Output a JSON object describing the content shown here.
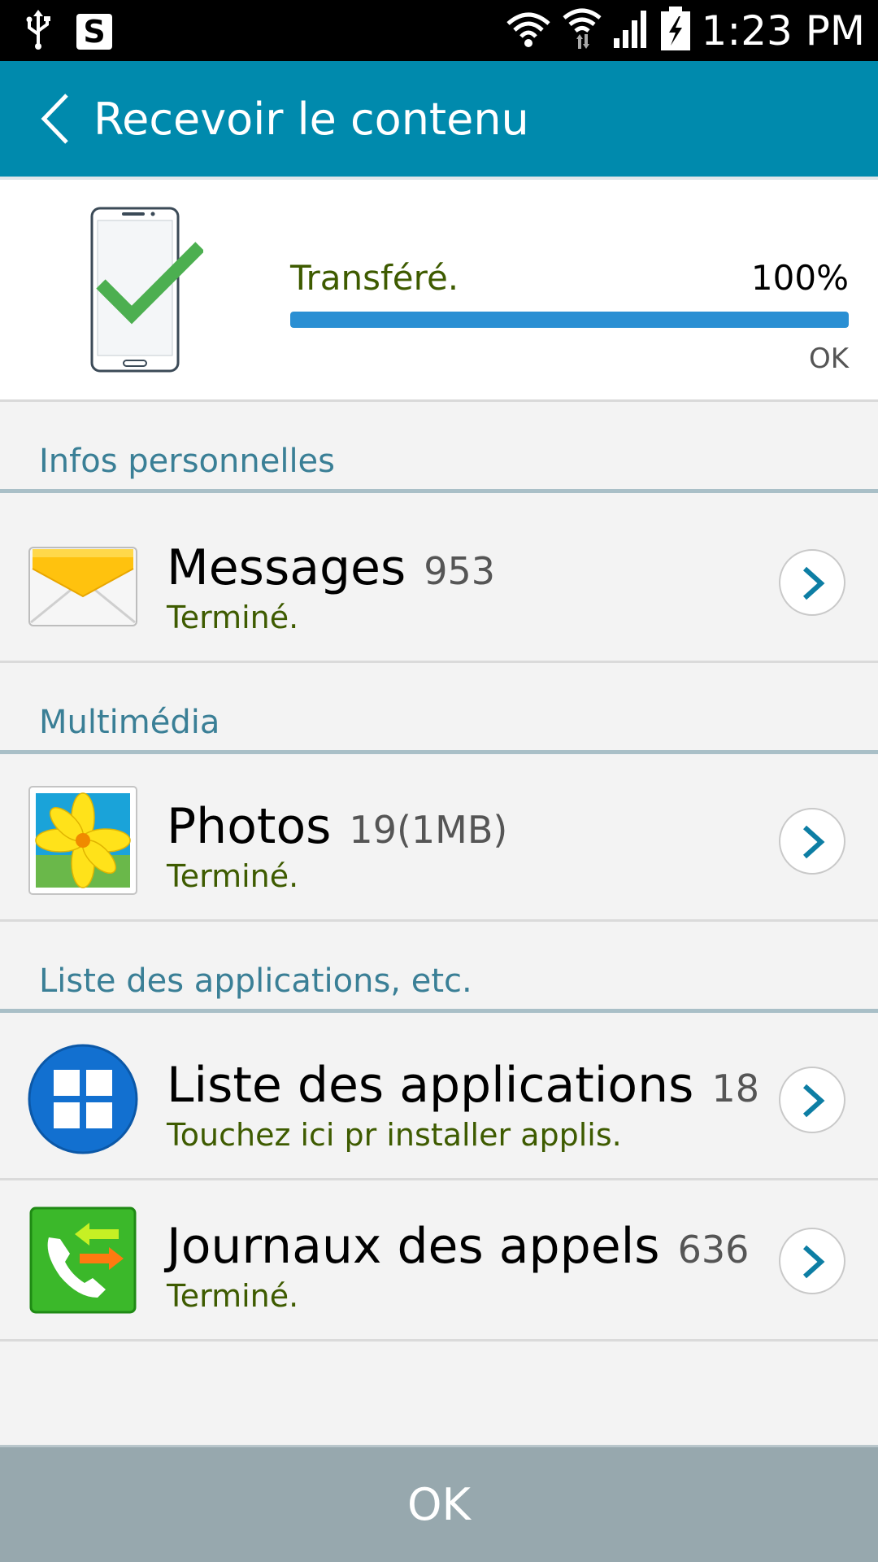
{
  "status_bar": {
    "time": "1:23 PM",
    "icons": [
      "usb-icon",
      "s-app-icon",
      "wifi-icon",
      "wifi-transfer-icon",
      "signal-icon",
      "battery-charging-icon"
    ]
  },
  "header": {
    "title": "Recevoir le contenu",
    "back_icon": "chevron-left-icon"
  },
  "progress": {
    "status": "Transféré.",
    "percent_label": "100%",
    "percent_value": 100,
    "ok_label": "OK",
    "accent": "#2a8fd3"
  },
  "sections": [
    {
      "label": "Infos personnelles",
      "items": [
        {
          "title": "Messages",
          "count": "953",
          "subtitle": "Terminé.",
          "icon": "envelope-icon"
        }
      ]
    },
    {
      "label": "Multimédia",
      "items": [
        {
          "title": "Photos",
          "count": "19(1MB)",
          "subtitle": "Terminé.",
          "icon": "photo-icon"
        }
      ]
    },
    {
      "label": "Liste des applications, etc.",
      "items": [
        {
          "title": "Liste des applications",
          "count": "18",
          "subtitle": "Touchez ici pr installer applis.",
          "icon": "apps-grid-icon"
        },
        {
          "title": "Journaux des appels",
          "count": "636",
          "subtitle": "Terminé.",
          "icon": "call-log-icon"
        }
      ]
    }
  ],
  "footer": {
    "ok_label": "OK"
  },
  "colors": {
    "action_bar": "#008aad",
    "section_label": "#3a7f96",
    "subtitle": "#3e5b00",
    "footer": "#97a8ae"
  }
}
